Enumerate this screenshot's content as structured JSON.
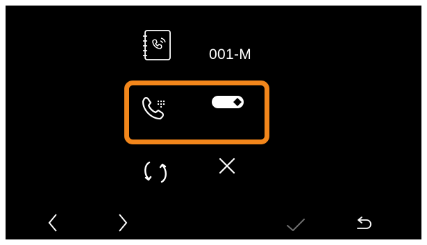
{
  "header": {
    "device_icon": "address-book-intercom-icon",
    "device_name": "001-M"
  },
  "call_forward_row": {
    "icon": "phone-forward-icon",
    "toggle": {
      "state": "on",
      "icon": "toggle-switch-icon"
    },
    "selected": true
  },
  "actions": {
    "refresh_icon": "refresh-icon",
    "delete_icon": "close-icon"
  },
  "footer": {
    "prev_icon": "chevron-left-icon",
    "next_icon": "chevron-right-icon",
    "confirm_icon": "check-icon",
    "back_icon": "return-icon"
  },
  "colors": {
    "background": "#000000",
    "foreground": "#ffffff",
    "highlight": "#f2861b",
    "confirm_dim": "#6f6f6f"
  }
}
